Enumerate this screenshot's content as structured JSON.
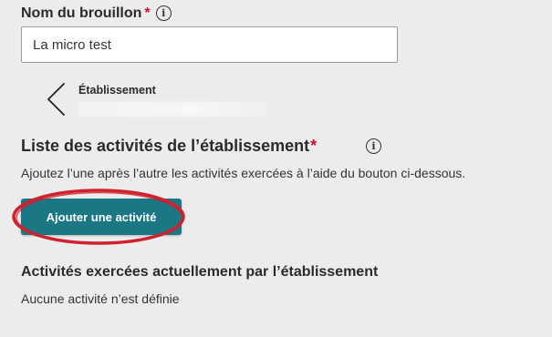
{
  "draft_name": {
    "label": "Nom du brouillon",
    "required_marker": "*",
    "value": "La micro test"
  },
  "establishment": {
    "label": "Établissement"
  },
  "activities": {
    "title": "Liste des activités de l’établissement",
    "required_marker": "*",
    "help_text": "Ajoutez l’une après l’autre les activités exercées à l’aide du bouton ci-dessous.",
    "add_button_label": "Ajouter une activité"
  },
  "current_activities": {
    "title": "Activités exercées actuellement par l’établissement",
    "empty_text": "Aucune activité n’est définie"
  },
  "icons": {
    "info": "info-icon",
    "back": "chevron-left-icon"
  },
  "colors": {
    "primary_button": "#1b7784",
    "required": "#c8102e",
    "annotation_circle": "#d0212e"
  }
}
